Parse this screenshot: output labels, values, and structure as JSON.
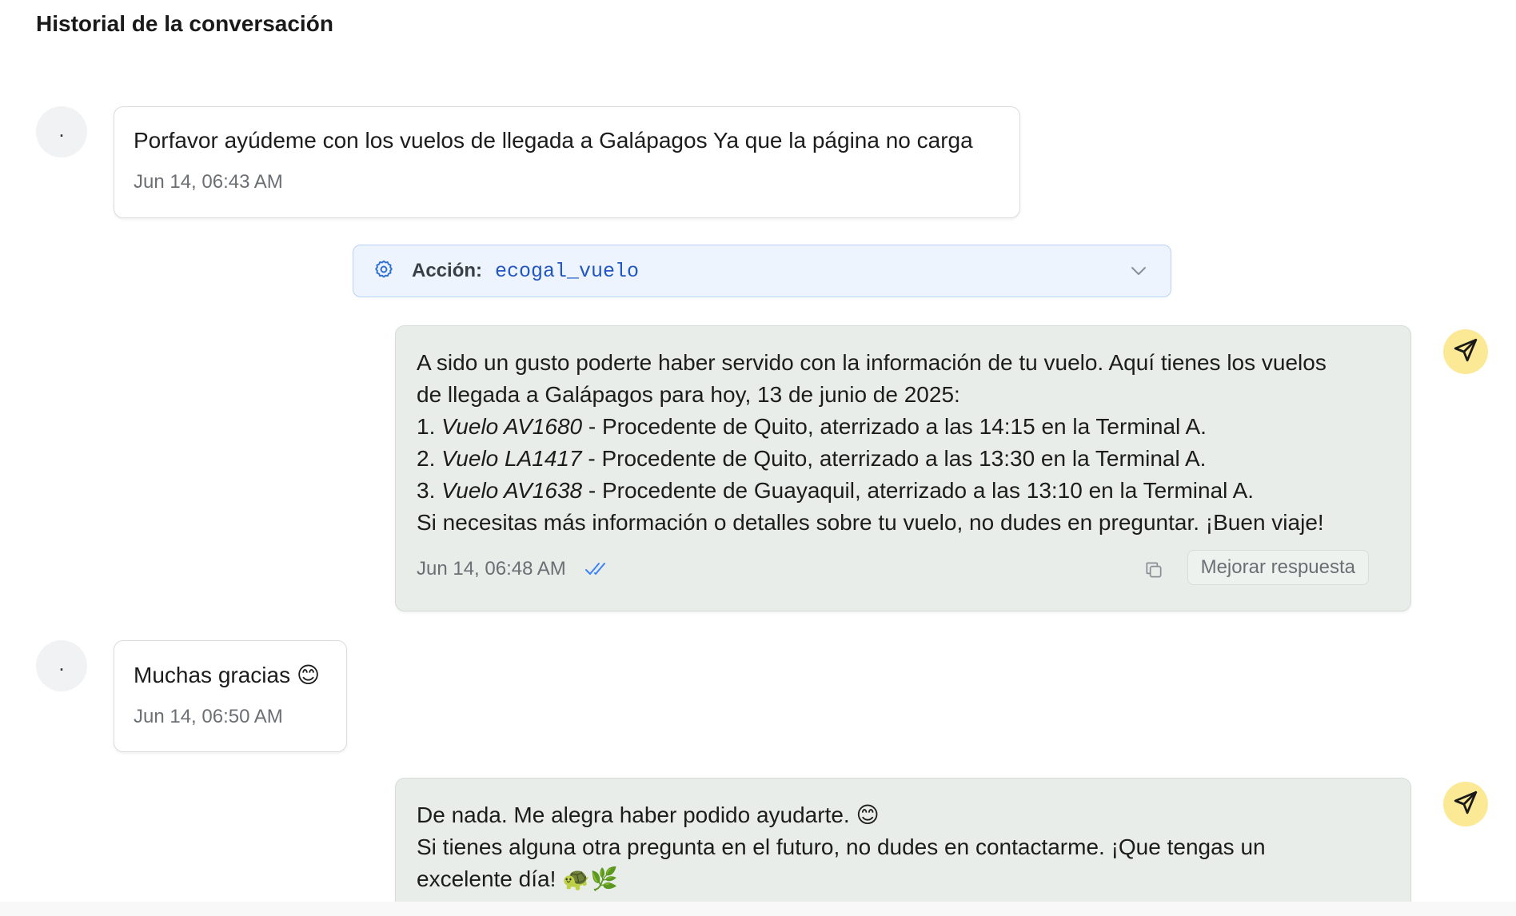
{
  "page": {
    "title": "Historial de la conversación"
  },
  "messages": [
    {
      "role": "user",
      "avatar": ".",
      "text": "Porfavor ayúdeme con los vuelos de llegada a Galápagos Ya que la página no carga",
      "time": "Jun 14, 06:43 AM"
    },
    {
      "role": "action",
      "label": "Acción:",
      "value": "ecogal_vuelo",
      "icon": "gear-icon",
      "expand_icon": "chevron-down-icon"
    },
    {
      "role": "assistant",
      "lines": {
        "l1": "A sido un gusto poderte haber servido con la información de tu vuelo. Aquí tienes los vuelos",
        "l2": "de llegada a Galápagos para hoy, 13 de junio de 2025:",
        "f1_num": "1.",
        "f1_name": "Vuelo AV1680",
        "f1_rest": "- Procedente de Quito, aterrizado a las 14:15 en la Terminal A.",
        "f2_num": "2.",
        "f2_name": "Vuelo LA1417",
        "f2_rest": "- Procedente de Quito, aterrizado a las 13:30 en la Terminal A.",
        "f3_num": "3.",
        "f3_name": "Vuelo AV1638",
        "f3_rest": "- Procedente de Guayaquil, aterrizado a las 13:10 en la Terminal A.",
        "l6": "Si necesitas más información o detalles sobre tu vuelo, no dudes en preguntar. ¡Buen viaje!"
      },
      "time": "Jun 14, 06:48 AM",
      "status_icon": "double-check-icon",
      "copy_icon": "copy-icon",
      "improve_label": "Mejorar respuesta",
      "avatar_icon": "send-icon"
    },
    {
      "role": "user",
      "avatar": ".",
      "text": "Muchas gracias 😊",
      "time": "Jun 14, 06:50 AM"
    },
    {
      "role": "assistant",
      "lines": {
        "l1": "De nada. Me alegra haber podido ayudarte. 😊",
        "l2": "Si tienes alguna otra pregunta en el futuro, no dudes en contactarme. ¡Que tengas un",
        "l3": "excelente día! 🐢🌿"
      },
      "avatar_icon": "send-icon"
    }
  ],
  "colors": {
    "assistant_bubble": "#e8ede9",
    "action_bg": "#edf4fe",
    "action_accent": "#2156c2",
    "bot_avatar": "#fbe995",
    "read_ticks": "#3b82f6"
  }
}
